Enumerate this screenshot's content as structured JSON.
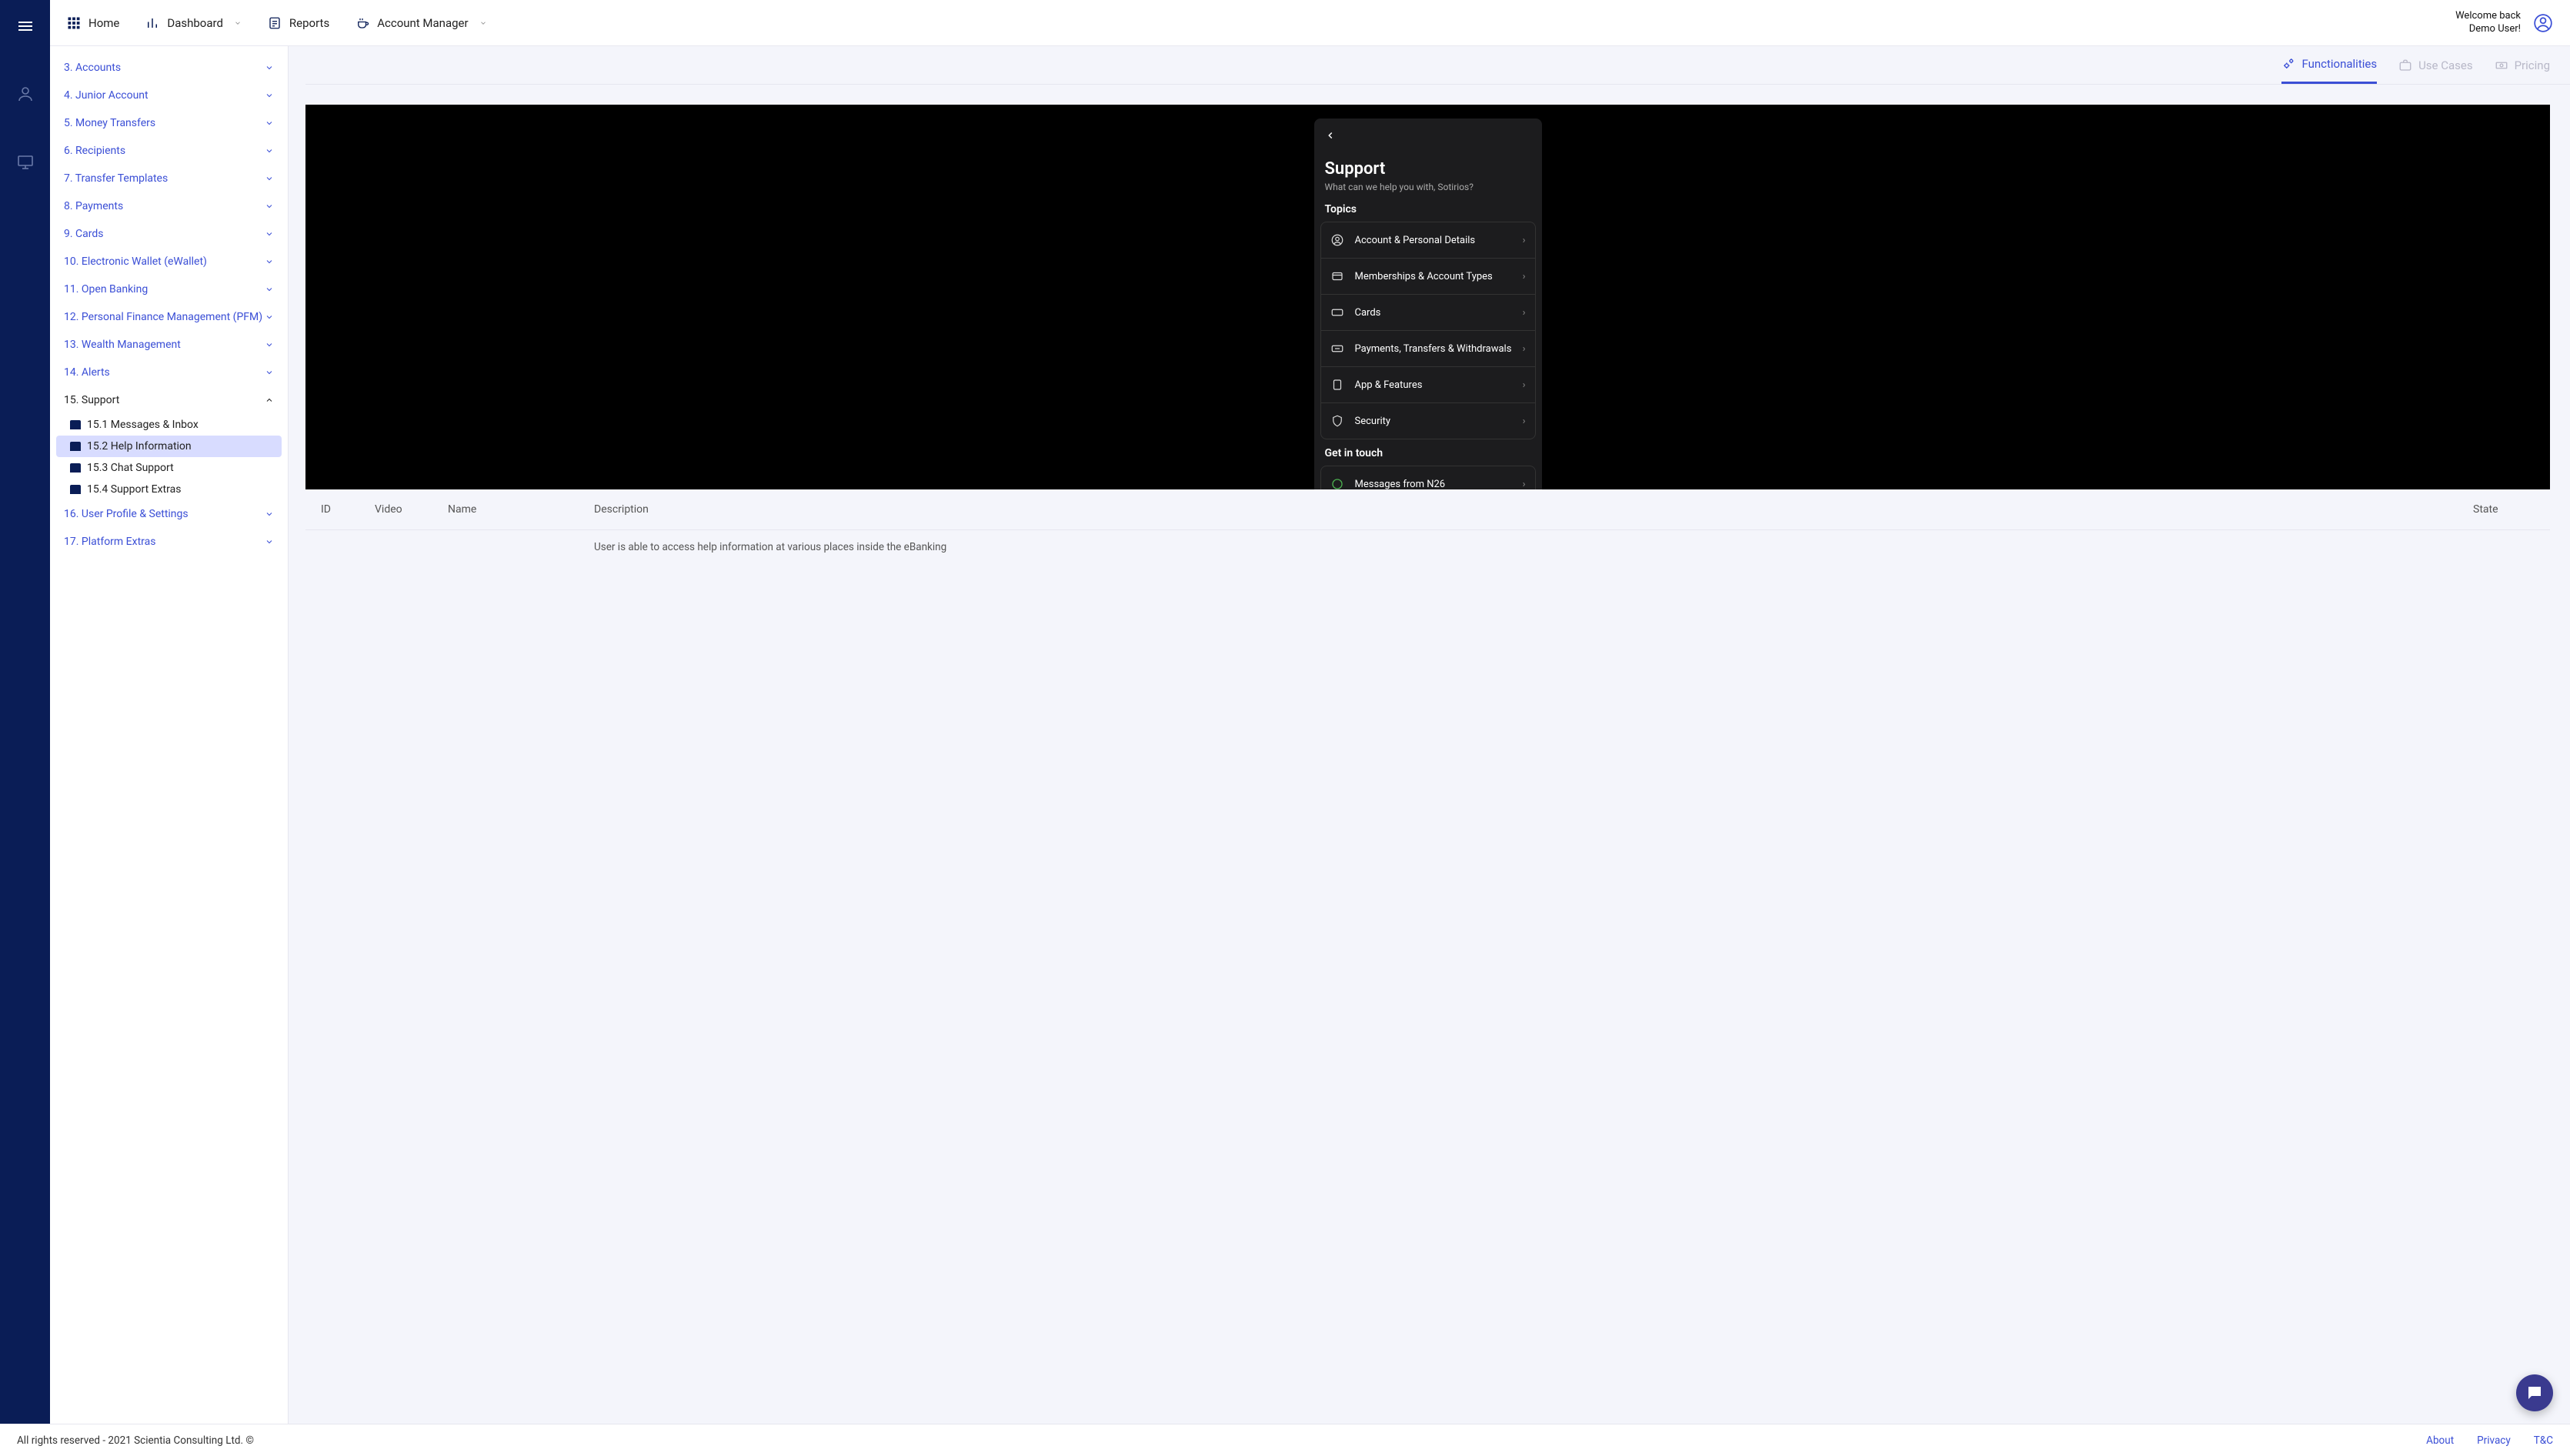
{
  "header": {
    "nav": [
      {
        "label": "Home",
        "caret": false
      },
      {
        "label": "Dashboard",
        "caret": true
      },
      {
        "label": "Reports",
        "caret": false
      },
      {
        "label": "Account Manager",
        "caret": true
      }
    ],
    "welcome_line1": "Welcome back",
    "welcome_line2": "Demo User!"
  },
  "sidebar": {
    "items": [
      {
        "label": "3. Accounts"
      },
      {
        "label": "4. Junior Account"
      },
      {
        "label": "5. Money Transfers"
      },
      {
        "label": "6. Recipients"
      },
      {
        "label": "7. Transfer Templates"
      },
      {
        "label": "8. Payments"
      },
      {
        "label": "9. Cards"
      },
      {
        "label": "10. Electronic Wallet (eWallet)"
      },
      {
        "label": "11. Open Banking"
      },
      {
        "label": "12. Personal Finance Management (PFM)"
      },
      {
        "label": "13. Wealth Management"
      },
      {
        "label": "14. Alerts"
      }
    ],
    "expanded": {
      "label": "15. Support"
    },
    "sub": [
      {
        "label": "15.1 Messages & Inbox"
      },
      {
        "label": "15.2 Help Information"
      },
      {
        "label": "15.3 Chat Support"
      },
      {
        "label": "15.4 Support Extras"
      }
    ],
    "after": [
      {
        "label": "16. User Profile & Settings"
      },
      {
        "label": "17. Platform Extras"
      }
    ]
  },
  "tabs": [
    {
      "label": "Functionalities",
      "active": true
    },
    {
      "label": "Use Cases",
      "active": false
    },
    {
      "label": "Pricing",
      "active": false
    }
  ],
  "phone": {
    "title": "Support",
    "subtitle": "What can we help you with, Sotirios?",
    "topics_hdr": "Topics",
    "topics": [
      "Account & Personal Details",
      "Memberships & Account Types",
      "Cards",
      "Payments, Transfers & Withdrawals",
      "App & Features",
      "Security"
    ],
    "getintouch_hdr": "Get in touch",
    "getintouch_item": "Messages from N26"
  },
  "table": {
    "headers": {
      "id": "ID",
      "video": "Video",
      "name": "Name",
      "desc": "Description",
      "state": "State"
    },
    "row": {
      "desc": "User is able to access help information at various places inside the eBanking"
    }
  },
  "footer": {
    "copyright": "All rights reserved - 2021 Scientia Consulting Ltd. ©",
    "links": [
      "About",
      "Privacy",
      "T&C"
    ]
  }
}
